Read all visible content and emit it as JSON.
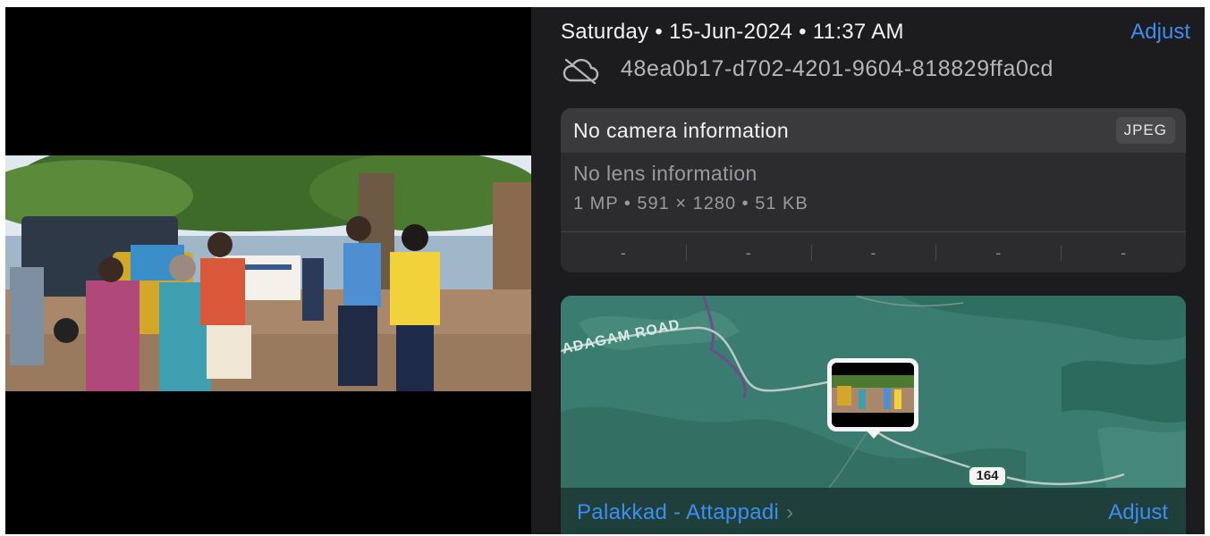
{
  "header": {
    "date_text": "Saturday • 15-Jun-2024 • 11:37 AM",
    "adjust_label": "Adjust",
    "sync_icon": "cloud-off-icon",
    "asset_id": "48ea0b17-d702-4201-9604-818829ffa0cd"
  },
  "camera": {
    "title": "No camera information",
    "format_badge": "JPEG",
    "lens": "No lens information",
    "specs": "1 MP • 591 × 1280 • 51 KB",
    "exif_values": [
      "-",
      "-",
      "-",
      "-",
      "-"
    ]
  },
  "map": {
    "road_label": "ADAGAM ROAD",
    "route_shield": "164",
    "location": "Palakkad - Attappadi",
    "chevron": "›",
    "adjust_label": "Adjust"
  },
  "colors": {
    "accent": "#3d8ef0",
    "panel": "#1c1c1e",
    "map_land": "#3a7d70"
  }
}
